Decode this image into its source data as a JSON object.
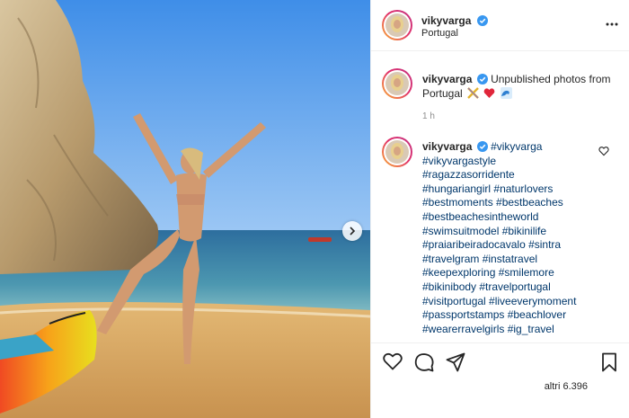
{
  "post": {
    "username": "vikyvarga",
    "location": "Portugal",
    "caption_username": "vikyvarga",
    "caption_text": "Unpublished photos from Portugal",
    "caption_emojis": [
      "crossed-swords-emoji",
      "red-heart-emoji",
      "wave-emoji"
    ],
    "time": "1 h",
    "comment_username": "vikyvarga",
    "comment_first_tag": "#vikyvarga",
    "hashtag_lines": [
      "#vikyvargastyle",
      "#ragazzasorridente",
      "#hungariangirl #naturlovers",
      "#bestmoments #bestbeaches",
      "#bestbeachesintheworld",
      "#swimsuitmodel #bikinilife",
      "#praiaribeiradocavalo #sintra",
      "#travelgram #instatravel",
      "#keepexploring #smilemore",
      "#bikinibody #travelportugal",
      "#visitportugal #liveeverymoment",
      "#passportstamps #beachlover",
      "#wearerravelgirls #ig_travel"
    ],
    "likes": "altri 6.396"
  },
  "icons": {
    "more": "more-horizontal-icon",
    "verified": "verified-badge-icon",
    "like": "heart-icon",
    "comment": "comment-icon",
    "share": "paper-plane-icon",
    "save": "bookmark-icon",
    "next": "chevron-right-icon"
  },
  "colors": {
    "verified": "#3897f0",
    "hashtag": "#00376b",
    "muted": "#8e8e8e",
    "story_ring_start": "#f9b233",
    "story_ring_end": "#c13584"
  }
}
